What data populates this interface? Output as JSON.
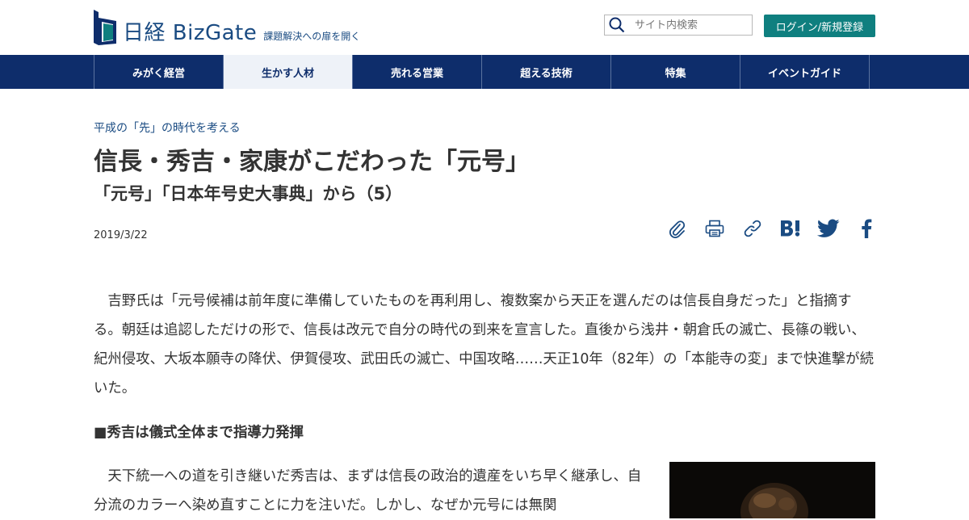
{
  "header": {
    "logo_name": "日経 BizGate",
    "logo_tagline": "課題解決への扉を開く",
    "search_placeholder": "サイト内検索",
    "login_label": "ログイン/新規登録"
  },
  "nav": {
    "items": [
      {
        "label": "みがく経営"
      },
      {
        "label": "生かす人材"
      },
      {
        "label": "売れる営業"
      },
      {
        "label": "超える技術"
      },
      {
        "label": "特集"
      },
      {
        "label": "イベントガイド"
      }
    ],
    "active_index": 1
  },
  "article": {
    "kicker": "平成の「先」の時代を考える",
    "title": "信長・秀吉・家康がこだわった「元号」",
    "subtitle": "「元号」「日本年号史大事典」から（5）",
    "date": "2019/3/22",
    "share_icons": [
      "clip-icon",
      "print-icon",
      "link-icon",
      "hatena-bookmark-icon",
      "twitter-icon",
      "facebook-icon"
    ],
    "paragraph1": "　吉野氏は「元号候補は前年度に準備していたものを再利用し、複数案から天正を選んだのは信長自身だった」と指摘する。朝廷は追認しただけの形で、信長は改元で自分の時代の到来を宣言した。直後から浅井・朝倉氏の滅亡、長篠の戦い、紀州侵攻、大坂本願寺の降伏、伊賀侵攻、武田氏の滅亡、中国攻略……天正10年（82年）の「本能寺の変」まで快進撃が続いた。",
    "section_heading": "■秀吉は儀式全体まで指導力発揮",
    "paragraph2": "　天下統一への道を引き継いだ秀吉は、まずは信長の政治的遺産をいち早く継承し、自分流のカラーへ染め直すことに力を注いだ。しかし、なぜか元号には無関"
  },
  "colors": {
    "brand_navy": "#0e2d6b",
    "brand_blue": "#1a4b82",
    "login_teal": "#0f7f7f",
    "nav_active_bg": "#eef2f8"
  }
}
